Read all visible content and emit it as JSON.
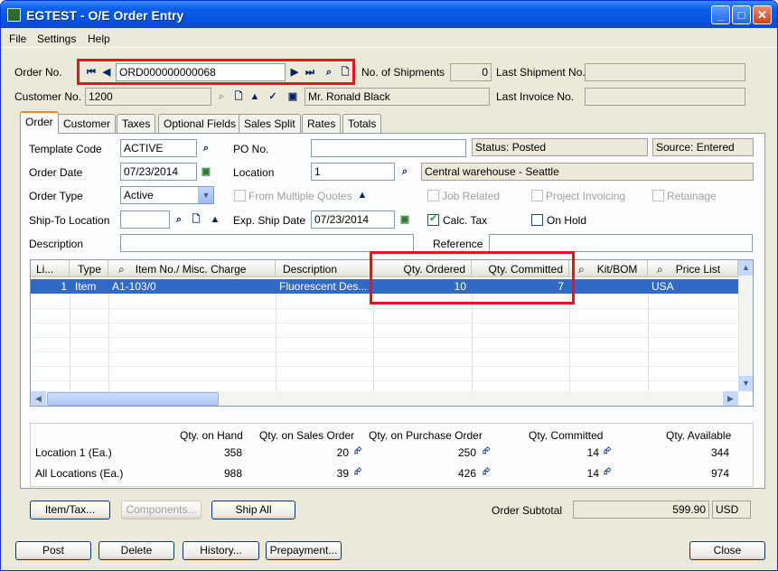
{
  "window": {
    "title": "EGTEST - O/E Order Entry",
    "min": "_",
    "max": "□",
    "close": "✕"
  },
  "menu": [
    "File",
    "Settings",
    "Help"
  ],
  "header": {
    "order_no_label": "Order No.",
    "order_no": "ORD000000000068",
    "shipments_label": "No. of Shipments",
    "shipments": "0",
    "last_ship_label": "Last Shipment No.",
    "last_ship": "",
    "customer_no_label": "Customer No.",
    "customer_no": "1200",
    "customer_name": "Mr. Ronald Black",
    "last_invoice_label": "Last Invoice No.",
    "last_invoice": ""
  },
  "tabs": [
    "Order",
    "Customer",
    "Taxes",
    "Optional Fields",
    "Sales Split",
    "Rates",
    "Totals"
  ],
  "order": {
    "template_label": "Template Code",
    "template": "ACTIVE",
    "po_label": "PO No.",
    "po": "",
    "status": "Status: Posted",
    "source": "Source: Entered",
    "date_label": "Order Date",
    "date": "07/23/2014",
    "location_label": "Location",
    "location": "1",
    "location_desc": "Central warehouse - Seattle",
    "type_label": "Order Type",
    "type": "Active",
    "multi_quotes": "From Multiple Quotes",
    "job_related": "Job Related",
    "project_invoicing": "Project Invoicing",
    "retainage": "Retainage",
    "shipto_label": "Ship-To Location",
    "shipto": "",
    "exp_ship_label": "Exp. Ship Date",
    "exp_ship": "07/23/2014",
    "calc_tax": "Calc. Tax",
    "on_hold": "On Hold",
    "desc_label": "Description",
    "desc": "",
    "ref_label": "Reference",
    "ref": ""
  },
  "grid": {
    "headers": [
      "Li...",
      "Type",
      "Item No./ Misc. Charge",
      "Description",
      "Qty. Ordered",
      "Qty. Committed",
      "Kit/BOM",
      "Price List"
    ],
    "rows": [
      {
        "line": "1",
        "type": "Item",
        "item": "A1-103/0",
        "desc": "Fluorescent Des...",
        "ordered": "10",
        "committed": "7",
        "kit": "",
        "price_list": "USA"
      }
    ]
  },
  "summary": {
    "headers": [
      "Qty. on Hand",
      "Qty. on Sales Order",
      "Qty. on Purchase Order",
      "Qty. Committed",
      "Qty. Available"
    ],
    "rows": [
      {
        "label": "Location  1 (Ea.)",
        "on_hand": "358",
        "on_so": "20",
        "on_po": "250",
        "committed": "14",
        "available": "344"
      },
      {
        "label": "All Locations (Ea.)",
        "on_hand": "988",
        "on_so": "39",
        "on_po": "426",
        "committed": "14",
        "available": "974"
      }
    ]
  },
  "buttons": {
    "item_tax": "Item/Tax...",
    "components": "Components...",
    "ship_all": "Ship All",
    "post": "Post",
    "delete": "Delete",
    "history": "History...",
    "prepayment": "Prepayment...",
    "close": "Close"
  },
  "subtotal": {
    "label": "Order Subtotal",
    "value": "599.90",
    "currency": "USD"
  }
}
